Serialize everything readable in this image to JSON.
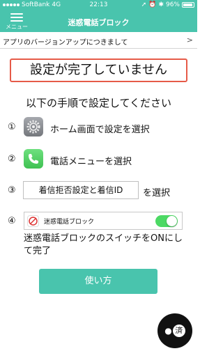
{
  "status": {
    "carrier": "SoftBank",
    "network": "4G",
    "time": "22:13",
    "battery": "96%"
  },
  "navbar": {
    "menu_label": "メニュー",
    "title": "迷惑電話ブロック"
  },
  "notice": {
    "text": "アプリのバージョンアップにつきまして",
    "chevron": ">"
  },
  "alert": "設定が完了していません",
  "subheading": "以下の手順で設定してください",
  "steps": [
    {
      "num": "①",
      "text": "ホーム画面で設定を選択",
      "icon": "settings-gear-icon"
    },
    {
      "num": "②",
      "text": "電話メニューを選択",
      "icon": "phone-icon"
    },
    {
      "num": "③",
      "boxed": "着信拒否設定と着信ID",
      "text": "を選択"
    },
    {
      "num": "④",
      "app_name": "迷惑電話ブロック",
      "toggle_on": true
    }
  ],
  "instruction": "迷惑電話ブロックのスイッチをONにして完了",
  "button_label": "使い方",
  "badge_text": "済",
  "colors": {
    "accent": "#49c4ad",
    "alert_border": "#e65a48",
    "toggle_on": "#4cd964"
  }
}
